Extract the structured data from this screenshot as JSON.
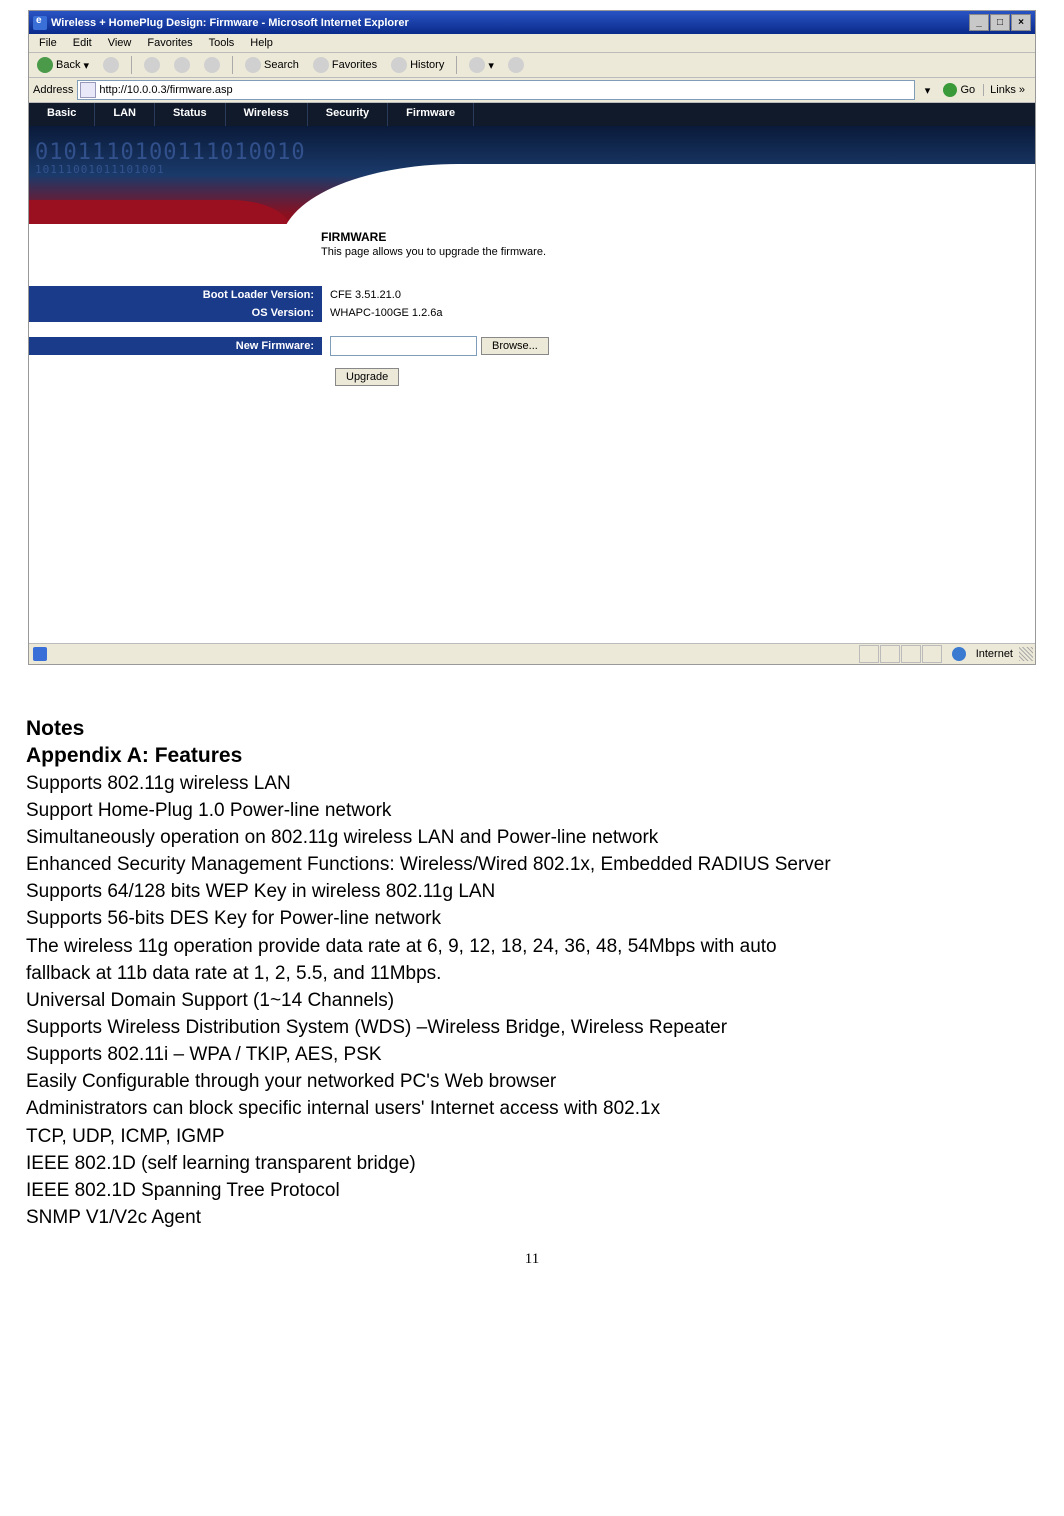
{
  "window": {
    "title": "Wireless + HomePlug Design: Firmware - Microsoft Internet Explorer",
    "min": "_",
    "max": "□",
    "close": "×"
  },
  "menubar": {
    "items": [
      "File",
      "Edit",
      "View",
      "Favorites",
      "Tools",
      "Help"
    ]
  },
  "toolbar": {
    "back": "Back",
    "search": "Search",
    "favorites": "Favorites",
    "history": "History"
  },
  "addressbar": {
    "label": "Address",
    "url": "http://10.0.0.3/firmware.asp",
    "go": "Go",
    "links": "Links »"
  },
  "tabs": [
    "Basic",
    "LAN",
    "Status",
    "Wireless",
    "Security",
    "Firmware"
  ],
  "page": {
    "title": "FIRMWARE",
    "subtitle": "This page allows you to upgrade the firmware.",
    "boot_label": "Boot Loader Version:",
    "boot_value": "CFE 3.51.21.0",
    "os_label": "OS Version:",
    "os_value": "WHAPC-100GE 1.2.6a",
    "new_fw_label": "New Firmware:",
    "browse": "Browse...",
    "upgrade": "Upgrade"
  },
  "statusbar": {
    "done_icon": "e",
    "zone": "Internet"
  },
  "doc": {
    "notes": "Notes",
    "appendix": "Appendix A: Features",
    "lines": [
      "Supports 802.11g wireless LAN",
      "Support Home-Plug 1.0 Power-line network",
      "Simultaneously operation on 802.11g wireless LAN and Power-line network",
      "Enhanced Security Management Functions: Wireless/Wired 802.1x, Embedded RADIUS Server",
      "Supports 64/128 bits WEP Key in wireless 802.11g LAN",
      "Supports 56-bits DES Key for Power-line network",
      "The wireless 11g operation provide data rate at 6, 9, 12, 18, 24, 36, 48, 54Mbps with auto",
      "fallback at 11b data rate at 1, 2, 5.5, and 11Mbps.",
      "Universal Domain Support (1~14 Channels)",
      "Supports Wireless Distribution System (WDS) –Wireless Bridge, Wireless Repeater",
      "Supports 802.11i – WPA / TKIP, AES, PSK",
      "Easily Configurable through your networked PC's Web browser",
      "Administrators can block specific internal users' Internet access with 802.1x",
      "TCP, UDP, ICMP, IGMP",
      "IEEE 802.1D (self learning transparent bridge)",
      "IEEE 802.1D Spanning Tree Protocol",
      "SNMP V1/V2c Agent"
    ],
    "page_number": "11"
  }
}
